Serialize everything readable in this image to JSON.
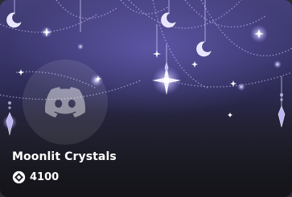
{
  "card": {
    "title": "Moonlit Crystals",
    "price": "4100",
    "currency_icon": "orb-diamond-icon",
    "avatar_icon": "discord-logo-icon"
  },
  "colors": {
    "background_top": "#45407a",
    "background_bottom": "#1f1f27",
    "glow": "#d8d4ff",
    "text": "#ffffff"
  }
}
